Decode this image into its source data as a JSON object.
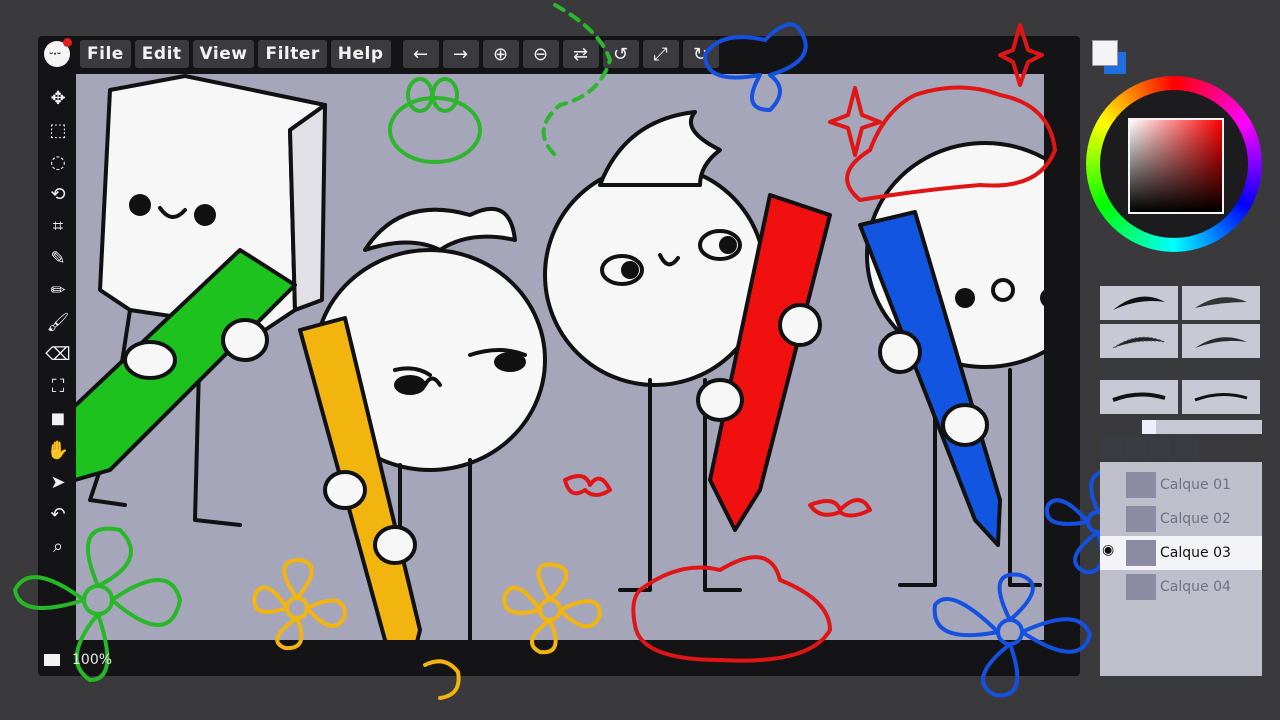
{
  "menubar": {
    "menus": [
      "File",
      "Edit",
      "View",
      "Filter",
      "Help"
    ],
    "tools": [
      {
        "name": "undo-icon",
        "glyph": "←"
      },
      {
        "name": "redo-icon",
        "glyph": "→"
      },
      {
        "name": "zoom-in-icon",
        "glyph": "⊕"
      },
      {
        "name": "zoom-out-icon",
        "glyph": "⊖"
      },
      {
        "name": "flip-icon",
        "glyph": "⇄"
      },
      {
        "name": "rotate-left-icon",
        "glyph": "↺"
      },
      {
        "name": "fit-screen-icon",
        "glyph": "⤢"
      },
      {
        "name": "rotate-right-icon",
        "glyph": "↻"
      }
    ]
  },
  "toolbar": {
    "tools": [
      {
        "name": "move-icon",
        "glyph": "✥"
      },
      {
        "name": "rect-select-icon",
        "glyph": "⬚"
      },
      {
        "name": "ellipse-select-icon",
        "glyph": "◌"
      },
      {
        "name": "lasso-icon",
        "glyph": "⟲"
      },
      {
        "name": "crop-icon",
        "glyph": "⌗"
      },
      {
        "name": "eyedropper-icon",
        "glyph": "✎"
      },
      {
        "name": "pencil-icon",
        "glyph": "✏"
      },
      {
        "name": "brush-icon",
        "glyph": "🖌"
      },
      {
        "name": "eraser-icon",
        "glyph": "⌫"
      },
      {
        "name": "bucket-icon",
        "glyph": "⛶"
      },
      {
        "name": "shape-icon",
        "glyph": "◼"
      },
      {
        "name": "hand-icon",
        "glyph": "✋"
      },
      {
        "name": "smudge-icon",
        "glyph": "➤"
      },
      {
        "name": "history-icon",
        "glyph": "↶"
      },
      {
        "name": "search-icon",
        "glyph": "⌕"
      }
    ]
  },
  "status": {
    "zoom": "100%"
  },
  "colors": {
    "foreground": "#f4f4f8",
    "background": "#1f6fe0",
    "canvas": "#a5a6b9",
    "green": "#1ec21e",
    "yellow": "#f2b40f",
    "red": "#f01010",
    "blue": "#1155e0"
  },
  "layers": [
    {
      "label": "Calque 01",
      "active": false
    },
    {
      "label": "Calque 02",
      "active": false
    },
    {
      "label": "Calque 03",
      "active": true
    },
    {
      "label": "Calque 04",
      "active": false
    }
  ]
}
